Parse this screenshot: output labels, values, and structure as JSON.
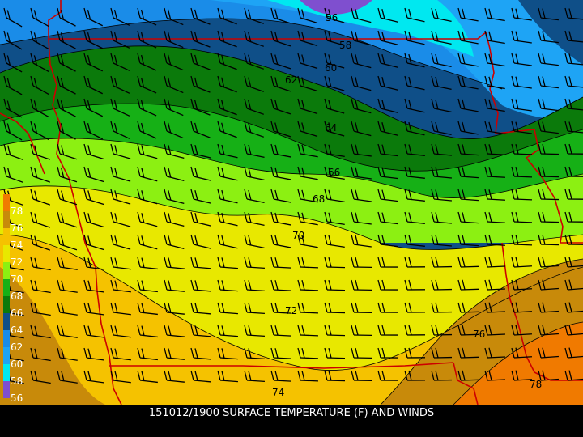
{
  "map": {
    "title": "151012/1900 SURFACE TEMPERATURE (F) AND WINDS",
    "units": "F",
    "temperature_bands": [
      {
        "value": 56,
        "color": "#7f4fcf"
      },
      {
        "value": 58,
        "color": "#00e8f0"
      },
      {
        "value": 60,
        "color": "#1ea4f5"
      },
      {
        "value": 62,
        "color": "#1a8ce8"
      },
      {
        "value": 64,
        "color": "#0f4f88"
      },
      {
        "value": 66,
        "color": "#0b7a0b"
      },
      {
        "value": 68,
        "color": "#16b016"
      },
      {
        "value": 70,
        "color": "#8cf012"
      },
      {
        "value": 72,
        "color": "#e8e800"
      },
      {
        "value": 74,
        "color": "#f5c200"
      },
      {
        "value": 76,
        "color": "#c88a0a"
      },
      {
        "value": 78,
        "color": "#f07a00"
      }
    ],
    "contour_labels": [
      "56",
      "58",
      "60",
      "62",
      "64",
      "66",
      "68",
      "70",
      "72",
      "74",
      "76",
      "78"
    ],
    "colorbar_labels": [
      "56",
      "58",
      "60",
      "62",
      "64",
      "66",
      "68",
      "70",
      "72",
      "74",
      "76",
      "78"
    ],
    "boundary_color": "#cc0000",
    "wind_barb_color": "#000000"
  }
}
